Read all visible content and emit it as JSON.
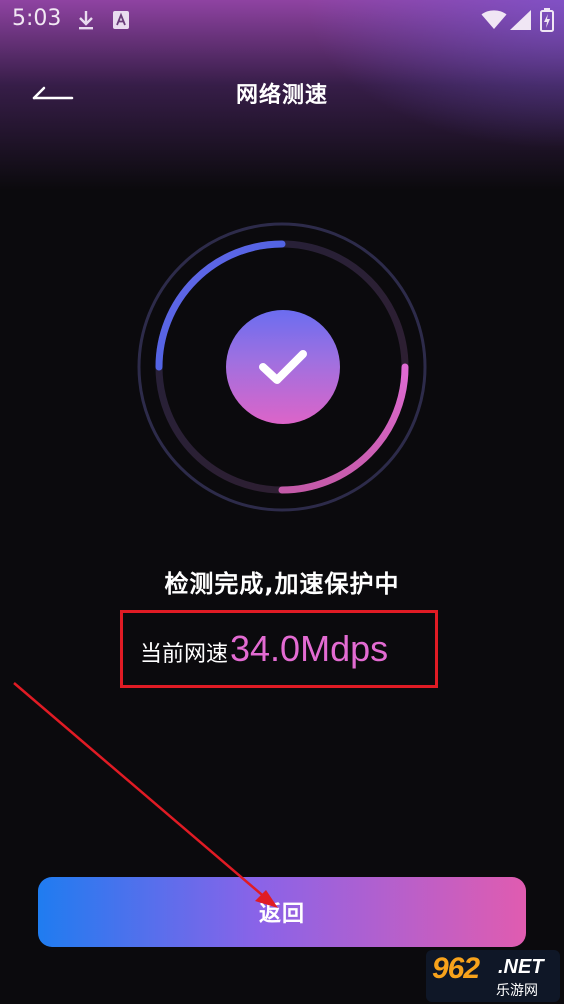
{
  "status_bar": {
    "time": "5:03",
    "icons": [
      "download-icon",
      "a-icon",
      "wifi-icon",
      "signal-icon",
      "battery-icon"
    ]
  },
  "header": {
    "title": "网络测速",
    "back_icon": "back-icon"
  },
  "result": {
    "status": "检测完成,加速保护中",
    "speed_label": "当前网速",
    "speed_value": "34.0Mdps"
  },
  "actions": {
    "return_label": "返回"
  },
  "watermark": {
    "logo": "962",
    "suffix": ".NET",
    "sub": "乐游网"
  },
  "colors": {
    "background": "#0b0a0d",
    "accent_blue": "#1f7cf0",
    "accent_pink": "#e05cb0",
    "speed_value": "#e36bd2",
    "highlight_box": "#e01b24",
    "annotation_arrow": "#e01b24"
  }
}
